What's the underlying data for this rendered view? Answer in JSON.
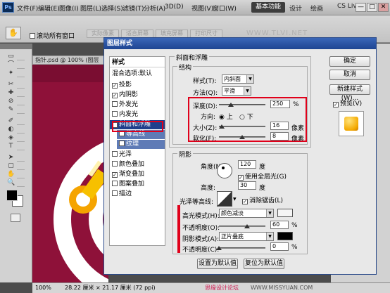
{
  "app": {
    "logo": "Ps"
  },
  "menu": [
    "文件(F)",
    "编辑(E)",
    "图像(I)",
    "图层(L)",
    "选择(S)",
    "滤镜(T)",
    "分析(A)",
    "3D(D)",
    "视图(V)",
    "窗口(W)"
  ],
  "workspace": {
    "essentials": "基本功能",
    "design": "设计",
    "painting": "绘画"
  },
  "cslive": "CS Live",
  "window_controls": [
    "—",
    "□",
    "✕"
  ],
  "options": {
    "scroll_all": "滚动所有窗口",
    "btn1": "实际像素",
    "btn2": "适合屏幕",
    "btn3": "填充屏幕",
    "btn4": "打印尺寸"
  },
  "doc": {
    "tab": "指针.psd @ 100% (图层"
  },
  "status": {
    "zoom": "100%",
    "info": "28.22 厘米 × 21.17 厘米 (72 ppi)"
  },
  "watermark": {
    "top": "WWW.TLVI.NET",
    "bottom": "思缘设计论坛",
    "bottom2": "WWW.MISSYUAN.COM"
  },
  "dialog": {
    "title": "图层样式",
    "styles_header": "样式",
    "blend_options": "混合选项:默认",
    "items": [
      {
        "label": "投影",
        "checked": true
      },
      {
        "label": "内阴影",
        "checked": true
      },
      {
        "label": "外发光",
        "checked": false
      },
      {
        "label": "内发光",
        "checked": false
      },
      {
        "label": "斜面和浮雕",
        "checked": true
      },
      {
        "label": "等高线",
        "checked": false
      },
      {
        "label": "纹理",
        "checked": false
      },
      {
        "label": "光泽",
        "checked": false
      },
      {
        "label": "颜色叠加",
        "checked": false
      },
      {
        "label": "渐变叠加",
        "checked": true
      },
      {
        "label": "图案叠加",
        "checked": false
      },
      {
        "label": "描边",
        "checked": false
      }
    ],
    "bevel": {
      "section": "斜面和浮雕",
      "structure": "结构",
      "style_label": "样式(T):",
      "style_value": "内斜面",
      "method_label": "方法(Q):",
      "method_value": "平滑",
      "depth_label": "深度(D):",
      "depth_value": "250",
      "depth_unit": "%",
      "depth_level": 0.25,
      "direction_label": "方向:",
      "dir_up": "上",
      "dir_down": "下",
      "size_label": "大小(Z):",
      "size_value": "16",
      "size_unit": "像素",
      "size_level": 0.065,
      "soften_label": "软化(F):",
      "soften_value": "8",
      "soften_unit": "像素",
      "soften_level": 0.5
    },
    "shading": {
      "section": "阴影",
      "angle_label": "角度(N):",
      "angle_value": "120",
      "angle_unit": "度",
      "global_light": "使用全局光(G)",
      "altitude_label": "高度:",
      "altitude_value": "30",
      "altitude_unit": "度",
      "gloss_label": "光泽等高线:",
      "antialias": "消除锯齿(L)",
      "highlight_label": "高光模式(H):",
      "highlight_value": "颜色减淡",
      "highlight_color": "#f5f5f5",
      "hl_opacity_label": "不透明度(O):",
      "hl_opacity_value": "60",
      "hl_opacity_level": 0.6,
      "shadow_label": "阴影模式(A):",
      "shadow_value": "正片叠底",
      "shadow_color": "#000000",
      "sh_opacity_label": "不透明度(C):",
      "sh_opacity_value": "0",
      "sh_opacity_level": 0.0,
      "pct": "%"
    },
    "default_set": "设置为默认值",
    "default_reset": "复位为默认值",
    "ok": "确定",
    "cancel": "取消",
    "new_style": "新建样式(W)...",
    "preview": "预览(V)"
  }
}
